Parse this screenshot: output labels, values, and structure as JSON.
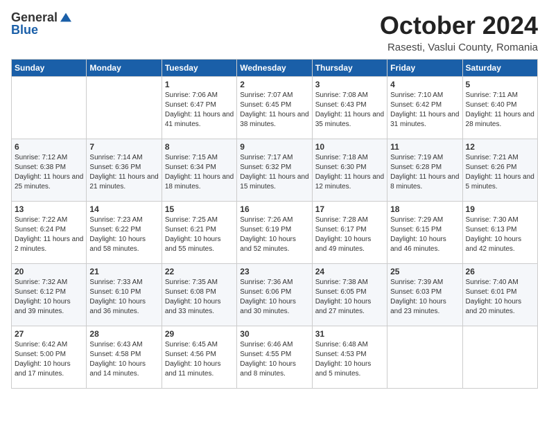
{
  "header": {
    "logo_general": "General",
    "logo_blue": "Blue",
    "month": "October 2024",
    "location": "Rasesti, Vaslui County, Romania"
  },
  "weekdays": [
    "Sunday",
    "Monday",
    "Tuesday",
    "Wednesday",
    "Thursday",
    "Friday",
    "Saturday"
  ],
  "weeks": [
    [
      {
        "day": "",
        "details": ""
      },
      {
        "day": "",
        "details": ""
      },
      {
        "day": "1",
        "details": "Sunrise: 7:06 AM\nSunset: 6:47 PM\nDaylight: 11 hours and 41 minutes."
      },
      {
        "day": "2",
        "details": "Sunrise: 7:07 AM\nSunset: 6:45 PM\nDaylight: 11 hours and 38 minutes."
      },
      {
        "day": "3",
        "details": "Sunrise: 7:08 AM\nSunset: 6:43 PM\nDaylight: 11 hours and 35 minutes."
      },
      {
        "day": "4",
        "details": "Sunrise: 7:10 AM\nSunset: 6:42 PM\nDaylight: 11 hours and 31 minutes."
      },
      {
        "day": "5",
        "details": "Sunrise: 7:11 AM\nSunset: 6:40 PM\nDaylight: 11 hours and 28 minutes."
      }
    ],
    [
      {
        "day": "6",
        "details": "Sunrise: 7:12 AM\nSunset: 6:38 PM\nDaylight: 11 hours and 25 minutes."
      },
      {
        "day": "7",
        "details": "Sunrise: 7:14 AM\nSunset: 6:36 PM\nDaylight: 11 hours and 21 minutes."
      },
      {
        "day": "8",
        "details": "Sunrise: 7:15 AM\nSunset: 6:34 PM\nDaylight: 11 hours and 18 minutes."
      },
      {
        "day": "9",
        "details": "Sunrise: 7:17 AM\nSunset: 6:32 PM\nDaylight: 11 hours and 15 minutes."
      },
      {
        "day": "10",
        "details": "Sunrise: 7:18 AM\nSunset: 6:30 PM\nDaylight: 11 hours and 12 minutes."
      },
      {
        "day": "11",
        "details": "Sunrise: 7:19 AM\nSunset: 6:28 PM\nDaylight: 11 hours and 8 minutes."
      },
      {
        "day": "12",
        "details": "Sunrise: 7:21 AM\nSunset: 6:26 PM\nDaylight: 11 hours and 5 minutes."
      }
    ],
    [
      {
        "day": "13",
        "details": "Sunrise: 7:22 AM\nSunset: 6:24 PM\nDaylight: 11 hours and 2 minutes."
      },
      {
        "day": "14",
        "details": "Sunrise: 7:23 AM\nSunset: 6:22 PM\nDaylight: 10 hours and 58 minutes."
      },
      {
        "day": "15",
        "details": "Sunrise: 7:25 AM\nSunset: 6:21 PM\nDaylight: 10 hours and 55 minutes."
      },
      {
        "day": "16",
        "details": "Sunrise: 7:26 AM\nSunset: 6:19 PM\nDaylight: 10 hours and 52 minutes."
      },
      {
        "day": "17",
        "details": "Sunrise: 7:28 AM\nSunset: 6:17 PM\nDaylight: 10 hours and 49 minutes."
      },
      {
        "day": "18",
        "details": "Sunrise: 7:29 AM\nSunset: 6:15 PM\nDaylight: 10 hours and 46 minutes."
      },
      {
        "day": "19",
        "details": "Sunrise: 7:30 AM\nSunset: 6:13 PM\nDaylight: 10 hours and 42 minutes."
      }
    ],
    [
      {
        "day": "20",
        "details": "Sunrise: 7:32 AM\nSunset: 6:12 PM\nDaylight: 10 hours and 39 minutes."
      },
      {
        "day": "21",
        "details": "Sunrise: 7:33 AM\nSunset: 6:10 PM\nDaylight: 10 hours and 36 minutes."
      },
      {
        "day": "22",
        "details": "Sunrise: 7:35 AM\nSunset: 6:08 PM\nDaylight: 10 hours and 33 minutes."
      },
      {
        "day": "23",
        "details": "Sunrise: 7:36 AM\nSunset: 6:06 PM\nDaylight: 10 hours and 30 minutes."
      },
      {
        "day": "24",
        "details": "Sunrise: 7:38 AM\nSunset: 6:05 PM\nDaylight: 10 hours and 27 minutes."
      },
      {
        "day": "25",
        "details": "Sunrise: 7:39 AM\nSunset: 6:03 PM\nDaylight: 10 hours and 23 minutes."
      },
      {
        "day": "26",
        "details": "Sunrise: 7:40 AM\nSunset: 6:01 PM\nDaylight: 10 hours and 20 minutes."
      }
    ],
    [
      {
        "day": "27",
        "details": "Sunrise: 6:42 AM\nSunset: 5:00 PM\nDaylight: 10 hours and 17 minutes."
      },
      {
        "day": "28",
        "details": "Sunrise: 6:43 AM\nSunset: 4:58 PM\nDaylight: 10 hours and 14 minutes."
      },
      {
        "day": "29",
        "details": "Sunrise: 6:45 AM\nSunset: 4:56 PM\nDaylight: 10 hours and 11 minutes."
      },
      {
        "day": "30",
        "details": "Sunrise: 6:46 AM\nSunset: 4:55 PM\nDaylight: 10 hours and 8 minutes."
      },
      {
        "day": "31",
        "details": "Sunrise: 6:48 AM\nSunset: 4:53 PM\nDaylight: 10 hours and 5 minutes."
      },
      {
        "day": "",
        "details": ""
      },
      {
        "day": "",
        "details": ""
      }
    ]
  ]
}
